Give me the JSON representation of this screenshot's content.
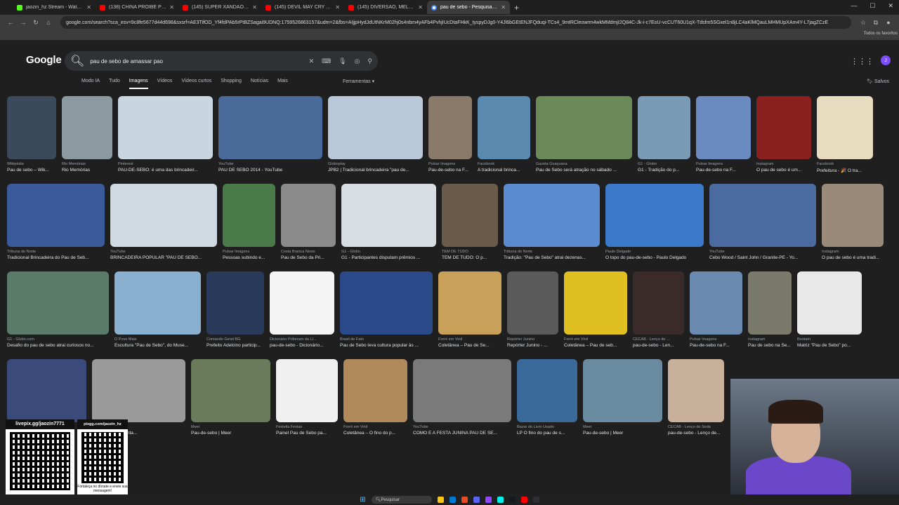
{
  "tabs": [
    {
      "label": "jaozin_hz Stream - Watch Live",
      "icon": "kick"
    },
    {
      "label": "(138) CHINA PROIBE PREGAÇÃ",
      "icon": "yt"
    },
    {
      "label": "(145) SUPER XANDÃO FALANDO",
      "icon": "yt"
    },
    {
      "label": "(145) DEVIL MAY CRY OFILME",
      "icon": "yt"
    },
    {
      "label": "(145) DIVERSÃO, MELHORES M",
      "icon": "yt"
    },
    {
      "label": "pau de sebo - Pesquisa Google",
      "icon": "g"
    }
  ],
  "url": "google.com/search?sca_esv=9c8fe5677d44d698&sxsrf=AE3TifOD_Yf4fdPAb5rPtBZSagai9UDNQ:1759526863157&udm=2&fbs=AIjjpHydJdUtNKrM02hj0s4nbm4yAFb4PvhjIUcDtaFHkK_tyspyDJg0-Y4Jl6bGEtENJFQduqi-TCs4_9mtRCleowrm4wkMMdmjI2Q84C-Jk-i-c7EoU-vcCUT60U1qX-Tdsfm5SGxel1n8jLC4aKlMQauLMHMUpXAm4Y-L7jagZCzE",
  "bookmarks_all": "Todos os favoritos",
  "logo": "Google",
  "search": {
    "query": "pau de sebo de amassar pao"
  },
  "nav": [
    "Modo IA",
    "Tudo",
    "Imagens",
    "Vídeos",
    "Vídeos curtos",
    "Shopping",
    "Notícias",
    "Mais"
  ],
  "nav_active": "Imagens",
  "tools": "Ferramentas",
  "saved": "Salvos",
  "rows": [
    [
      {
        "w": 70,
        "color": "#3a4a5a",
        "src": "Wikipédia",
        "cap": "Pau de sebo – Wik..."
      },
      {
        "w": 72,
        "color": "#8a9aa0",
        "src": "Rio Memórias",
        "cap": "Rio Memórias"
      },
      {
        "w": 135,
        "color": "#c9d6e0",
        "src": "Pinterest",
        "cap": "PAU-DE-SEBO: é uma das brincadeir..."
      },
      {
        "w": 148,
        "color": "#4a6a9a",
        "src": "YouTube",
        "cap": "PAU DE SEBO 2014 - YouTube"
      },
      {
        "w": 135,
        "color": "#b9c9d9",
        "src": "Globoplay",
        "cap": "JPB2 | Tradicional brincadeira \"pau de..."
      },
      {
        "w": 62,
        "color": "#8a7a6a",
        "src": "Pulsar Imagens",
        "cap": "Pau-de-sebo na F..."
      },
      {
        "w": 75,
        "color": "#5a8ab0",
        "src": "Facebook",
        "cap": "A tradicional brinca..."
      },
      {
        "w": 137,
        "color": "#6a8a5a",
        "src": "Gazeta Guaçuana",
        "cap": "Pau de Sebo será atração no sábado ..."
      },
      {
        "w": 75,
        "color": "#7a9ab5",
        "src": "G1 - Globo",
        "cap": "G1 - Tradição do p..."
      },
      {
        "w": 78,
        "color": "#6a8ac0",
        "src": "Pulsar Imagens",
        "cap": "Pau-de-sebo na F..."
      },
      {
        "w": 78,
        "color": "#8a2020",
        "src": "Instagram",
        "cap": "O pau de sebo é um..."
      },
      {
        "w": 80,
        "color": "#e8dcc0",
        "src": "Facebook",
        "cap": "Prefeitura - 🎉 O tra..."
      }
    ],
    [
      {
        "w": 139,
        "color": "#3a5a9a",
        "src": "Tribuna do Norte",
        "cap": "Tradicional Brincadeira do Pau de Seb..."
      },
      {
        "w": 152,
        "color": "#d0d8e0",
        "src": "YouTube",
        "cap": "BRINCADEIRA POPULAR \"PAU DE SEBO..."
      },
      {
        "w": 75,
        "color": "#4a7a4a",
        "src": "Pulsar Imagens",
        "cap": "Pessoas subindo e..."
      },
      {
        "w": 78,
        "color": "#8a8a8a",
        "src": "Costa Branca News",
        "cap": "Pau de Sebo da Pri..."
      },
      {
        "w": 135,
        "color": "#d8dde3",
        "src": "G1 - Globo",
        "cap": "G1 - Participantes disputam prêmios ..."
      },
      {
        "w": 80,
        "color": "#6a5a4a",
        "src": "TEM DE TUDO",
        "cap": "TEM DE TUDO: O p..."
      },
      {
        "w": 137,
        "color": "#5a8ad0",
        "src": "Tribuna do Norte",
        "cap": "Tradição: \"Pau de Sebo\" atrai dezenas..."
      },
      {
        "w": 140,
        "color": "#3a7ac9",
        "src": "Paulo Delgado",
        "cap": "O topo do pau-de-sebo - Paulo Delgado"
      },
      {
        "w": 152,
        "color": "#4a6aa0",
        "src": "YouTube",
        "cap": "Cebo Wood / Saint John / Granite-PE - Yo..."
      },
      {
        "w": 88,
        "color": "#9a8a7a",
        "src": "Instagram",
        "cap": "O pau de sebo é uma tradi..."
      }
    ],
    [
      {
        "w": 145,
        "color": "#5a7a6a",
        "src": "G1 - Globo.com",
        "cap": "Desafio do pau de sebo atrai curiosos no..."
      },
      {
        "w": 123,
        "color": "#8ab0d0",
        "src": "O Povo Mais",
        "cap": "Escultura \"Pau de Sebo\", do Muse..."
      },
      {
        "w": 82,
        "color": "#2a3a5a",
        "src": "Comando Geral BG",
        "cap": "Prefeito Adelcino particip..."
      },
      {
        "w": 92,
        "color": "#f4f4f4",
        "src": "Dicionário Priberam da Lí...",
        "cap": "pau-de-sebo - Dicionário..."
      },
      {
        "w": 132,
        "color": "#2a4a8a",
        "src": "Brasil de Fato",
        "cap": "Pau de Sebo leva cultura popular às ..."
      },
      {
        "w": 90,
        "color": "#c9a05a",
        "src": "Forró em Vinil",
        "cap": "Coletânea – Pau de Se..."
      },
      {
        "w": 73,
        "color": "#5a5a5a",
        "src": "Repórter Junino",
        "cap": "Repórter Junino - ..."
      },
      {
        "w": 90,
        "color": "#e0c020",
        "src": "Forró em Vinil",
        "cap": "Coletânea – Pau de seb..."
      },
      {
        "w": 73,
        "color": "#3a2a2a",
        "src": "CECAB - Lenço de ...",
        "cap": "pau-de-sebo - Len..."
      },
      {
        "w": 75,
        "color": "#6a8ab0",
        "src": "Pulsar Imagens",
        "cap": "Pau-de-sebo na F..."
      },
      {
        "w": 62,
        "color": "#7a7a6a",
        "src": "Instagram",
        "cap": "Pau de sebo na Se..."
      },
      {
        "w": 92,
        "color": "#e8e8e8",
        "src": "Bootam",
        "cap": "Matriz \"Pau de Sebo\" po..."
      }
    ],
    [
      {
        "w": 113,
        "color": "#3a4a7a",
        "src": "",
        "cap": ""
      },
      {
        "w": 133,
        "color": "#9a9a9a",
        "src": "Costa Branca News",
        "cap": "Princesa movimenta..."
      },
      {
        "w": 113,
        "color": "#6a7a5a",
        "src": "Meer",
        "cap": "Pau-de-sebo | Meer"
      },
      {
        "w": 88,
        "color": "#f0f0f0",
        "src": "Festella Festas",
        "cap": "Painel Pau de Sebo pa..."
      },
      {
        "w": 91,
        "color": "#b08a5a",
        "src": "Forró em Vinil",
        "cap": "Coletânea – O fino do p..."
      },
      {
        "w": 140,
        "color": "#7a7a7a",
        "src": "YouTube",
        "cap": "COMO É A FESTA JUNINA PAU DE SE..."
      },
      {
        "w": 86,
        "color": "#3a6a9a",
        "src": "Bazar do Livro Usado",
        "cap": "LP O fino do pau de s..."
      },
      {
        "w": 113,
        "color": "#6a8aa0",
        "src": "Meer",
        "cap": "Pau-de-sebo | Meer"
      },
      {
        "w": 80,
        "color": "#c9b09a",
        "src": "CECAB - Lenço de Seda",
        "cap": "pau-de-sebo - Lenço de..."
      }
    ]
  ],
  "overlay": {
    "livepix": "livepix.gg/jaozin7771",
    "pixgg": "pixgg.com/jaozin_hz",
    "pixgg_note": "Fortaleça no donate e envie sua mensagem!"
  },
  "taskbar": {
    "search": "Pesquisar"
  }
}
